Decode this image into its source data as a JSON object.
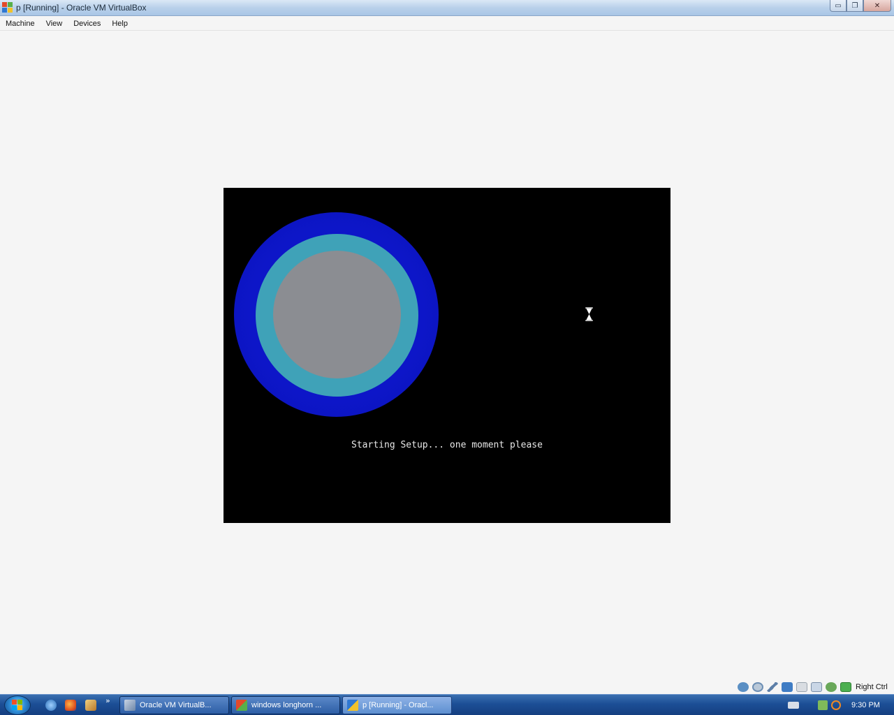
{
  "window": {
    "title": "p [Running] - Oracle VM VirtualBox",
    "controls": {
      "minimize": "▭",
      "restore": "❐",
      "close": "✕"
    }
  },
  "menubar": {
    "items": [
      {
        "label": "Machine"
      },
      {
        "label": "View"
      },
      {
        "label": "Devices"
      },
      {
        "label": "Help"
      }
    ]
  },
  "vm": {
    "status_text": "Starting Setup... one moment please",
    "colors": {
      "outer_ring": "#0d16c8",
      "middle_ring": "#3fa2b8",
      "inner_disc": "#8b8d92"
    }
  },
  "statusbar": {
    "icons": [
      "hard-disk-icon",
      "optical-drive-icon",
      "usb-icon",
      "network-icon",
      "shared-folders-icon",
      "display-icon",
      "virtualization-icon",
      "mouse-integration-icon"
    ],
    "host_key": "Right Ctrl"
  },
  "taskbar": {
    "quick_launch": [
      "browser-icon",
      "firefox-icon",
      "tool-icon"
    ],
    "more": "»",
    "buttons": [
      {
        "label": "Oracle VM VirtualB...",
        "icon": "virtualbox-icon",
        "active": false
      },
      {
        "label": "windows longhorn ...",
        "icon": "window-icon",
        "active": false
      },
      {
        "label": "p [Running] - Oracl...",
        "icon": "window-icon",
        "active": true
      }
    ],
    "tray_icons": [
      "keyboard-icon",
      "network-tray-icon",
      "search-tray-icon"
    ],
    "clock": "9:30 PM"
  }
}
